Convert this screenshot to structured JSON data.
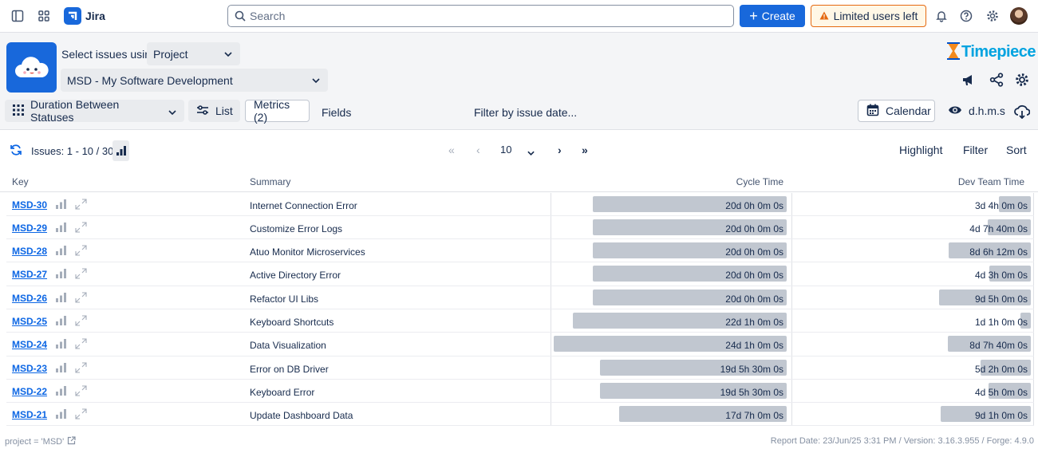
{
  "topnav": {
    "app_name": "Jira",
    "search_placeholder": "Search",
    "create_label": "Create",
    "limited_label": "Limited users left"
  },
  "header": {
    "select_label": "Select issues using",
    "select_mode": "Project",
    "project": "MSD - My Software Development",
    "brand": "Timepiece",
    "report_type": "Duration Between Statuses",
    "list_label": "List",
    "metrics_label": "Metrics (2)",
    "fields_label": "Fields",
    "filter_date_label": "Filter by issue date...",
    "calendar_label": "Calendar",
    "format_label": "d.h.m.s"
  },
  "toolbar": {
    "issues_label": "Issues: 1 - 10 / 30",
    "page_size": "10",
    "highlight": "Highlight",
    "filter": "Filter",
    "sort": "Sort"
  },
  "table": {
    "columns": [
      "Key",
      "Summary",
      "Cycle Time",
      "Dev Team Time"
    ],
    "rows": [
      {
        "key": "MSD-30",
        "summary": "Internet Connection Error",
        "cycle": "20d 0h 0m 0s",
        "cycle_days": 20,
        "dev": "3d 4h 0m 0s",
        "dev_days": 3.17
      },
      {
        "key": "MSD-29",
        "summary": "Customize Error Logs",
        "cycle": "20d 0h 0m 0s",
        "cycle_days": 20,
        "dev": "4d 7h 40m 0s",
        "dev_days": 4.32
      },
      {
        "key": "MSD-28",
        "summary": "Atuo Monitor Microservices",
        "cycle": "20d 0h 0m 0s",
        "cycle_days": 20,
        "dev": "8d 6h 12m 0s",
        "dev_days": 8.26
      },
      {
        "key": "MSD-27",
        "summary": "Active Directory Error",
        "cycle": "20d 0h 0m 0s",
        "cycle_days": 20,
        "dev": "4d 3h 0m 0s",
        "dev_days": 4.13
      },
      {
        "key": "MSD-26",
        "summary": "Refactor UI Libs",
        "cycle": "20d 0h 0m 0s",
        "cycle_days": 20,
        "dev": "9d 5h 0m 0s",
        "dev_days": 9.21
      },
      {
        "key": "MSD-25",
        "summary": "Keyboard Shortcuts",
        "cycle": "22d 1h 0m 0s",
        "cycle_days": 22.04,
        "dev": "1d 1h 0m 0s",
        "dev_days": 1.04
      },
      {
        "key": "MSD-24",
        "summary": "Data Visualization",
        "cycle": "24d 1h 0m 0s",
        "cycle_days": 24.04,
        "dev": "8d 7h 40m 0s",
        "dev_days": 8.32
      },
      {
        "key": "MSD-23",
        "summary": "Error on DB Driver",
        "cycle": "19d 5h 30m 0s",
        "cycle_days": 19.23,
        "dev": "5d 2h 0m 0s",
        "dev_days": 5.08
      },
      {
        "key": "MSD-22",
        "summary": "Keyboard Error",
        "cycle": "19d 5h 30m 0s",
        "cycle_days": 19.23,
        "dev": "4d 5h 0m 0s",
        "dev_days": 4.21
      },
      {
        "key": "MSD-21",
        "summary": "Update Dashboard Data",
        "cycle": "17d 7h 0m 0s",
        "cycle_days": 17.29,
        "dev": "9d 1h 0m 0s",
        "dev_days": 9.04
      }
    ]
  },
  "footer": {
    "query": "project = 'MSD'",
    "report_info": "Report Date: 23/Jun/25 3:31 PM / Version: 3.16.3.955 / Forge: 4.9.0"
  },
  "colors": {
    "accent": "#1868db",
    "bar": "#c1c7d0",
    "warning": "#e56910",
    "link": "#0c66e4"
  }
}
